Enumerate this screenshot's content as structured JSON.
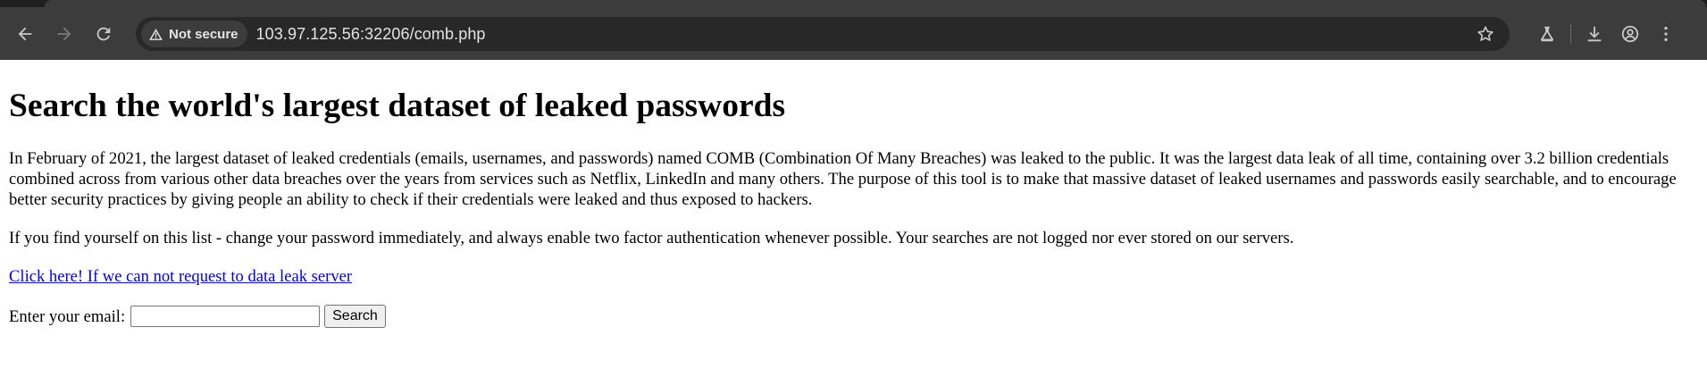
{
  "browser": {
    "security_label": "Not secure",
    "url": "103.97.125.56:32206/comb.php",
    "icons": [
      "back-icon",
      "forward-icon",
      "reload-icon",
      "warning-icon",
      "star-icon",
      "labs-icon",
      "download-icon",
      "profile-icon",
      "menu-icon"
    ]
  },
  "page": {
    "heading": "Search the world's largest dataset of leaked passwords",
    "intro": "In February of 2021, the largest dataset of leaked credentials (emails, usernames, and passwords) named COMB (Combination Of Many Breaches) was leaked to the public. It was the largest data leak of all time, containing over 3.2 billion credentials combined across from various other data breaches over the years from services such as Netflix, LinkedIn and many others. The purpose of this tool is to make that massive dataset of leaked usernames and passwords easily searchable, and to encourage better security practices by giving people an ability to check if their credentials were leaked and thus exposed to hackers.",
    "note": "If you find yourself on this list - change your password immediately, and always enable two factor authentication whenever possible. Your searches are not logged nor ever stored on our servers.",
    "link_text": "Click here! If we can not request to data leak server",
    "email_label": "Enter your email:",
    "email_value": "",
    "search_button": "Search"
  }
}
